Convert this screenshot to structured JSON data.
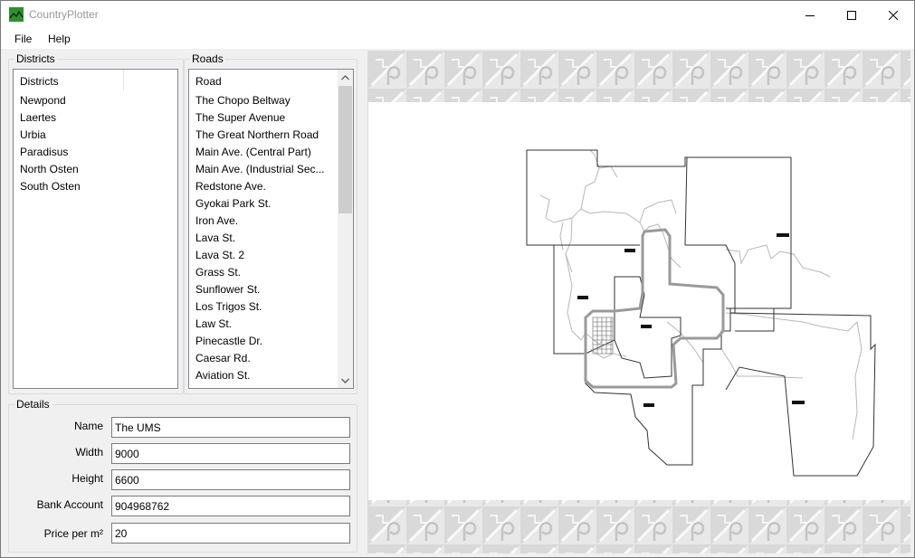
{
  "window": {
    "title": "CountryPlotter",
    "buttons": [
      "minimize",
      "maximize",
      "close"
    ]
  },
  "menu": {
    "items": [
      "File",
      "Help"
    ]
  },
  "districts": {
    "group_label": "Districts",
    "column_header": "Districts",
    "items": [
      "Newpond",
      "Laertes",
      "Urbia",
      "Paradisus",
      "North Osten",
      "South Osten"
    ]
  },
  "roads": {
    "group_label": "Roads",
    "column_header": "Road",
    "items": [
      "The Chopo Beltway",
      "The Super Avenue",
      "The Great Northern Road",
      "Main Ave. (Central Part)",
      "Main Ave. (Industrial Sec...",
      "Redstone Ave.",
      "Gyokai Park St.",
      "Iron Ave.",
      "Lava St.",
      "Lava St. 2",
      "Grass St.",
      "Sunflower St.",
      "Los Trigos St.",
      "Law St.",
      "Pinecastle Dr.",
      "Caesar Rd.",
      "Aviation St."
    ]
  },
  "details": {
    "group_label": "Details",
    "fields": {
      "name": {
        "label": "Name",
        "value": "The UMS"
      },
      "width": {
        "label": "Width",
        "value": "9000"
      },
      "height": {
        "label": "Height",
        "value": "6600"
      },
      "bank_account": {
        "label": "Bank Account",
        "value": "904968762"
      },
      "price": {
        "label": "Price per m²",
        "value": "20"
      }
    }
  },
  "colors": {
    "app_icon": "#2f8f2f",
    "list_border": "#828790",
    "scroll_thumb": "#cdcdcd",
    "banner": "#dcdcdc"
  }
}
